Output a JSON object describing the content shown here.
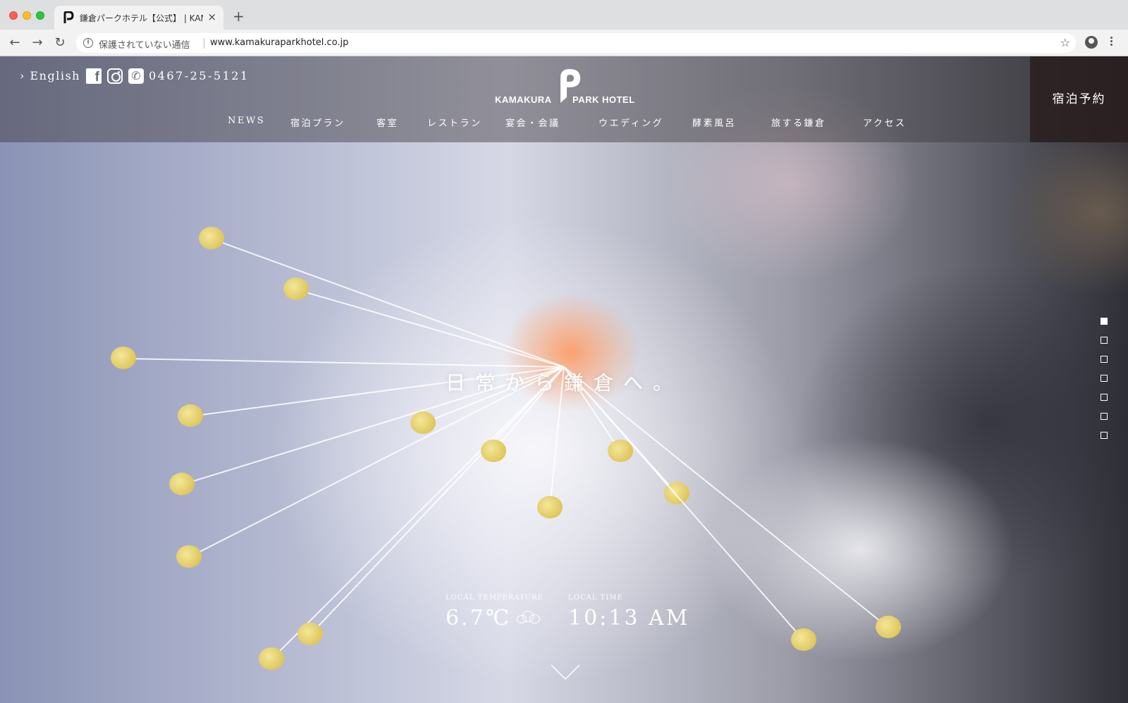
{
  "browser": {
    "tab_title": "鎌倉パークホテル【公式】 | KAMAKURA PARK HOTEL",
    "tab_close": "×",
    "new_tab": "+",
    "security_label": "保護されていない通信",
    "url": "www.kamakuraparkhotel.co.jp",
    "back": "←",
    "forward": "→",
    "reload": "↻",
    "star": "☆"
  },
  "header": {
    "lang_link": "› English",
    "phone": "0467-25-5121",
    "logo_left": "KAMAKURA",
    "logo_right": "PARK HOTEL",
    "reserve_label": "宿泊予約",
    "nav": [
      {
        "label": "NEWS"
      },
      {
        "label": "宿泊プラン"
      },
      {
        "label": "客室"
      },
      {
        "label": "レストラン"
      },
      {
        "label": "宴会・会議"
      },
      {
        "label": "ウエディング"
      },
      {
        "label": "酵素風呂"
      },
      {
        "label": "旅する鎌倉"
      },
      {
        "label": "アクセス"
      }
    ]
  },
  "hero": {
    "catchphrase": "日常から鎌倉へ。",
    "slides_total": 7,
    "active_slide": 1
  },
  "weather": {
    "temp_label": "LOCAL TEMPERATURE",
    "temp_value": "6.7℃",
    "time_label": "LOCAL TIME",
    "time_value": "10:13 AM",
    "condition_icon": "cloud-icon"
  },
  "colors": {
    "header_overlay": "#3c373c",
    "reserve_bg": "#281c1c",
    "text": "#ffffff"
  }
}
